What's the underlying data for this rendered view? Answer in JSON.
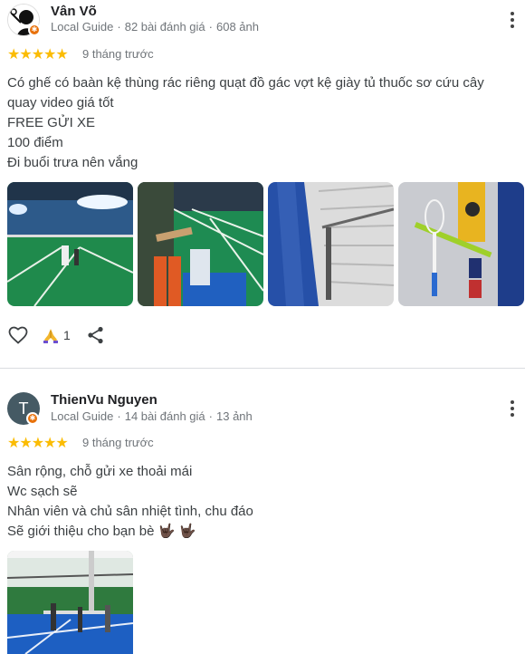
{
  "reviews": [
    {
      "name": "Vân Võ",
      "badge": "Local Guide",
      "reviews_count": "82 bài đánh giá",
      "photos_count": "608 ảnh",
      "stars": "★★★★★",
      "rating": 5,
      "time": "9 tháng trước",
      "lines": [
        "Có ghế có baàn kệ thùng rác riêng quạt đồ gác vợt kệ giày tủ thuốc sơ cứu cây",
        "quay video giá tốt",
        "FREE GỬI XE",
        "100 điểm",
        "Đi buổi trưa nên vắng"
      ],
      "reaction_count": "1"
    },
    {
      "name": "ThienVu Nguyen",
      "avatar_letter": "T",
      "badge": "Local Guide",
      "reviews_count": "14 bài đánh giá",
      "photos_count": "13 ảnh",
      "stars": "★★★★★",
      "rating": 5,
      "time": "9 tháng trước",
      "lines": [
        "Sân rộng, chỗ gửi xe thoải mái",
        "Wc sạch sẽ",
        "Nhân viên và chủ sân nhiệt tình, chu đáo",
        "Sẽ giới thiệu cho bạn bè 🤟🏿 🤟🏿"
      ]
    }
  ],
  "colors": {
    "star": "#fbbc04",
    "court_green": "#1f8a4c",
    "badge": "#e8710a"
  },
  "icons": [
    "heart-icon",
    "praise-hands-icon",
    "share-icon",
    "more-vert-icon",
    "local-guide-icon"
  ]
}
